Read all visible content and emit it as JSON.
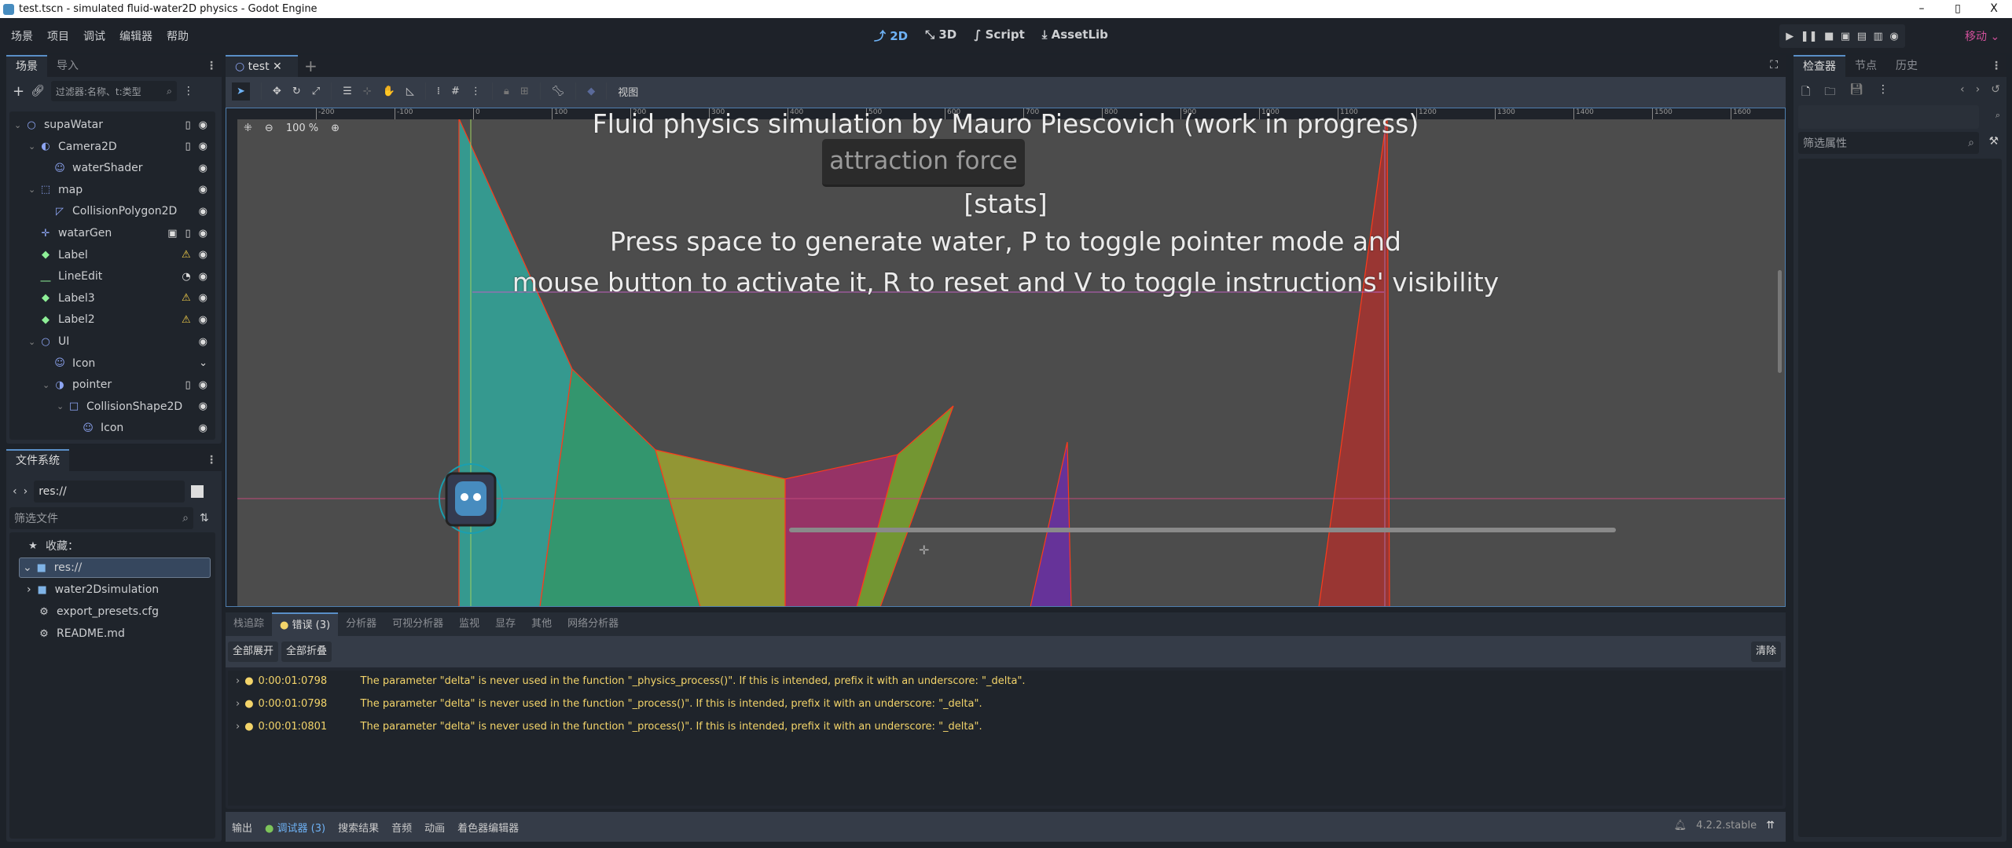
{
  "window": {
    "title": "test.tscn - simulated fluid-water2D physics - Godot Engine",
    "min": "–",
    "max": "▯",
    "close": "X"
  },
  "menu": [
    "场景",
    "项目",
    "调试",
    "编辑器",
    "帮助"
  ],
  "main_screens": [
    {
      "label": "2D",
      "active": true
    },
    {
      "label": "3D"
    },
    {
      "label": "Script"
    },
    {
      "label": "AssetLib"
    }
  ],
  "run_mode": "移动",
  "scene_dock": {
    "tabs": [
      "场景",
      "导入"
    ],
    "filter_placeholder": "过滤器:名称、t:类型",
    "nodes": [
      {
        "name": "supaWatar",
        "level": 0,
        "icon": "node2d-icon",
        "color": "#8da5f3",
        "arrow": true,
        "badges": [
          "script-icon",
          "eye-icon"
        ]
      },
      {
        "name": "Camera2D",
        "level": 1,
        "icon": "camera-icon",
        "color": "#8da5f3",
        "arrow": true,
        "badges": [
          "script-icon",
          "eye-icon"
        ]
      },
      {
        "name": "waterShader",
        "level": 2,
        "icon": "sprite-icon",
        "color": "#8da5f3",
        "badges": [
          "eye-icon"
        ]
      },
      {
        "name": "map",
        "level": 1,
        "icon": "tilemap-icon",
        "color": "#8da5f3",
        "arrow": true,
        "badges": [
          "eye-icon"
        ]
      },
      {
        "name": "CollisionPolygon2D",
        "level": 2,
        "icon": "collision-polygon-icon",
        "color": "#8da5f3",
        "badges": [
          "eye-icon"
        ]
      },
      {
        "name": "watarGen",
        "level": 1,
        "icon": "marker-icon",
        "color": "#8da5f3",
        "badges": [
          "group-icon",
          "script-icon",
          "eye-icon"
        ]
      },
      {
        "name": "Label",
        "level": 1,
        "icon": "label-icon",
        "color": "#8eef97",
        "badges": [
          "warning-icon",
          "eye-icon"
        ]
      },
      {
        "name": "LineEdit",
        "level": 1,
        "icon": "lineedit-icon",
        "color": "#8eef97",
        "badges": [
          "signal-icon",
          "eye-icon"
        ]
      },
      {
        "name": "Label3",
        "level": 1,
        "icon": "label-icon",
        "color": "#8eef97",
        "badges": [
          "warning-icon",
          "eye-icon"
        ]
      },
      {
        "name": "Label2",
        "level": 1,
        "icon": "label-icon",
        "color": "#8eef97",
        "badges": [
          "warning-icon",
          "eye-icon"
        ]
      },
      {
        "name": "UI",
        "level": 1,
        "icon": "node2d-icon",
        "color": "#8da5f3",
        "arrow": true,
        "badges": [
          "eye-icon"
        ]
      },
      {
        "name": "Icon",
        "level": 2,
        "icon": "sprite-icon",
        "color": "#8da5f3",
        "badges": [
          "collapse-icon"
        ]
      },
      {
        "name": "pointer",
        "level": 2,
        "icon": "area-icon",
        "color": "#8da5f3",
        "arrow": true,
        "badges": [
          "script-icon",
          "eye-icon"
        ]
      },
      {
        "name": "CollisionShape2D",
        "level": 3,
        "icon": "collision-shape-icon",
        "color": "#8da5f3",
        "arrow": true,
        "badges": [
          "eye-icon"
        ]
      },
      {
        "name": "Icon",
        "level": 4,
        "icon": "sprite-icon",
        "color": "#8da5f3",
        "badges": [
          "eye-icon"
        ]
      }
    ]
  },
  "fs_dock": {
    "tab": "文件系统",
    "path": "res://",
    "filter_placeholder": "筛选文件",
    "favorites": "收藏：",
    "items": [
      {
        "name": "res://",
        "icon": "folder-icon",
        "selected": true
      },
      {
        "name": "water2Dsimulation",
        "icon": "folder-icon"
      },
      {
        "name": "export_presets.cfg",
        "icon": "file-icon"
      },
      {
        "name": "README.md",
        "icon": "file-icon"
      }
    ]
  },
  "editor": {
    "scene_tab": "test",
    "view_menu": "视图",
    "zoom": "100 %",
    "ruler_x": [
      "-200",
      "-100",
      "0",
      "100",
      "200",
      "300",
      "400",
      "500",
      "600",
      "700",
      "800",
      "900",
      "1000",
      "1100",
      "1200",
      "1300",
      "1400",
      "1500",
      "1600"
    ],
    "game_text": {
      "title": "Fluid physics simulation by Mauro Piescovich (work in progress)",
      "button": "attraction force",
      "stats": "[stats]",
      "line1": "Press space to generate water, P to toggle pointer mode and",
      "line2": "mouse button to activate it, R to reset and V to toggle instructions' visibility"
    },
    "colors": {
      "teal": "#35998f",
      "green": "#33966e",
      "olive": "#929634",
      "magenta": "#963366",
      "lime": "#739632",
      "purple": "#663399",
      "red": "#993633",
      "outline": "#ff3a1a",
      "bg": "#4c4c4c"
    }
  },
  "debugger": {
    "tabs": [
      "栈追踪",
      "错误 (3)",
      "分析器",
      "可视分析器",
      "监视",
      "显存",
      "其他",
      "网络分析器"
    ],
    "expand_all": "全部展开",
    "collapse_all": "全部折叠",
    "clear": "清除",
    "errors": [
      {
        "time": "0:00:01:0798",
        "msg": "The parameter \"delta\" is never used in the function \"_physics_process()\". If this is intended, prefix it with an underscore: \"_delta\"."
      },
      {
        "time": "0:00:01:0798",
        "msg": "The parameter \"delta\" is never used in the function \"_process()\". If this is intended, prefix it with an underscore: \"_delta\"."
      },
      {
        "time": "0:00:01:0801",
        "msg": "The parameter \"delta\" is never used in the function \"_process()\". If this is intended, prefix it with an underscore: \"_delta\"."
      }
    ]
  },
  "bottom_bar": {
    "tabs": [
      "输出",
      "调试器 (3)",
      "搜索结果",
      "音频",
      "动画",
      "着色器编辑器"
    ],
    "version": "4.2.2.stable"
  },
  "inspector": {
    "tabs": [
      "检查器",
      "节点",
      "历史"
    ],
    "filter_placeholder": "筛选属性"
  }
}
